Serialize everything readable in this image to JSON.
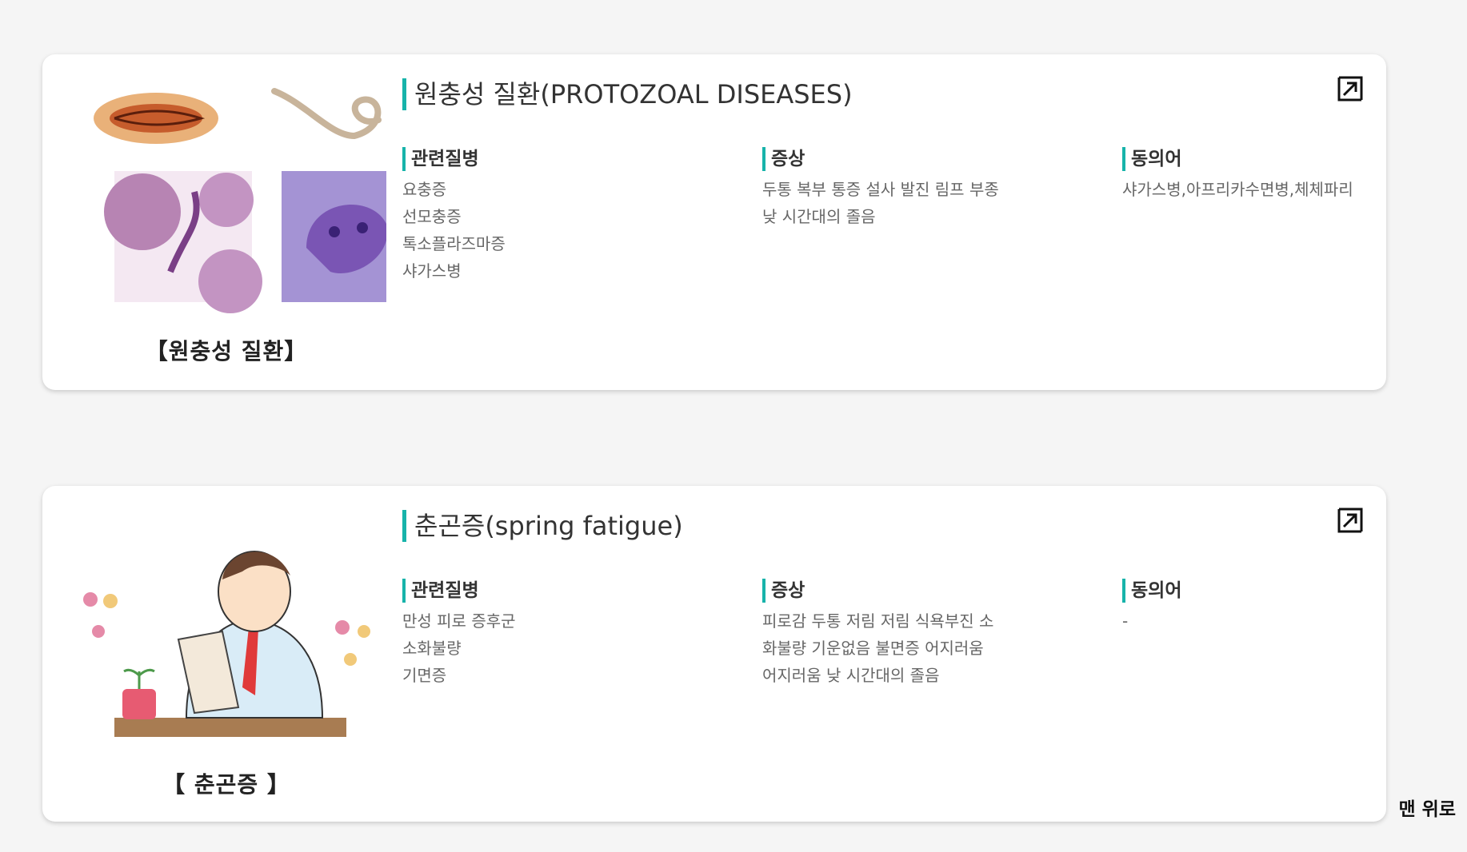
{
  "cards": [
    {
      "title": "원충성 질환(PROTOZOAL DISEASES)",
      "image_caption": "【원충성 질환】",
      "related": {
        "heading": "관련질병",
        "items": [
          "요충증",
          "선모충증",
          "톡소플라즈마증",
          "샤가스병"
        ]
      },
      "symptoms": {
        "heading": "증상",
        "text": "두통 복부 통증 설사 발진 림프 부종 낮 시간대의 졸음"
      },
      "synonyms": {
        "heading": "동의어",
        "text": "샤가스병,아프리카수면병,체체파리"
      },
      "open_icon": "external-link-icon"
    },
    {
      "title": "춘곤증(spring fatigue)",
      "image_caption": "【 춘곤증 】",
      "related": {
        "heading": "관련질병",
        "items": [
          "만성 피로 증후군",
          "소화불량",
          "기면증"
        ]
      },
      "symptoms": {
        "heading": "증상",
        "text": "피로감 두통 저림 저림 식욕부진 소화불량 기운없음 불면증 어지러움 어지러움 낮 시간대의 졸음"
      },
      "synonyms": {
        "heading": "동의어",
        "text": "-"
      },
      "open_icon": "external-link-icon"
    }
  ],
  "top_link": "맨 위로",
  "colors": {
    "accent": "#17b3aa",
    "background": "#f5f5f5",
    "card": "#ffffff"
  }
}
